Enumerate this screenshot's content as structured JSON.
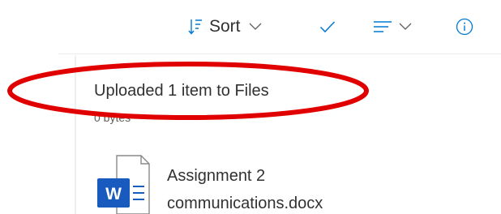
{
  "toolbar": {
    "sort_label": "Sort",
    "icons": [
      "sort-icon",
      "chevron-down-icon",
      "checkmark-icon",
      "view-options-icon",
      "chevron-down-icon",
      "info-icon"
    ],
    "accent_color": "#0078d4"
  },
  "notification": {
    "title": "Uploaded 1 item to Files",
    "subtitle": "0 bytes",
    "highlight_color": "#e00000"
  },
  "file": {
    "name_line1": "Assignment 2",
    "name_line2": "communications.docx",
    "icon": "word-document-icon",
    "icon_letter": "W",
    "icon_color": "#185abd"
  }
}
